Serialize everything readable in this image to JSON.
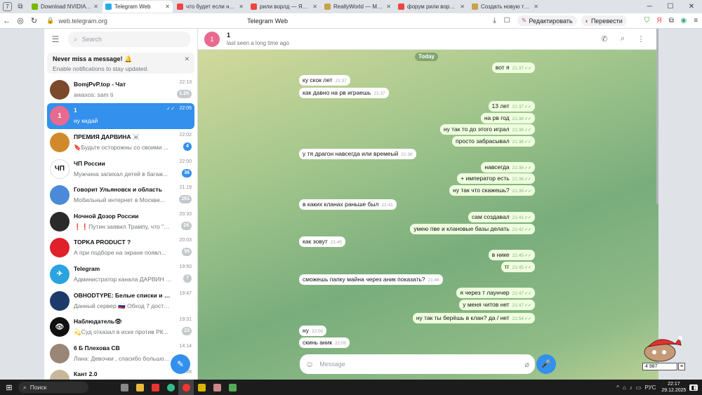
{
  "browser": {
    "tab_count": "7",
    "tabs": [
      {
        "label": "Download NVIDIA App for",
        "color": "#76b900"
      },
      {
        "label": "Telegram Web",
        "color": "#2aabee",
        "active": true
      },
      {
        "label": "что будет если написать",
        "color": "#e44"
      },
      {
        "label": "рили ворлд — Яндекс: на",
        "color": "#e44"
      },
      {
        "label": "ReallyWorld — Магазин пр",
        "color": "#c8a24a"
      },
      {
        "label": "форум рили ворлд — Ян",
        "color": "#e44"
      },
      {
        "label": "Создать новую тему - Rea",
        "color": "#c8a24a"
      }
    ],
    "url": "web.telegram.org",
    "page_title": "Telegram Web",
    "edit_label": "Редактировать",
    "translate_label": "Перевести"
  },
  "sidebar": {
    "search_placeholder": "Search",
    "notice_title": "Never miss a message! 🔔",
    "notice_sub": "Enable notifications to stay updated.",
    "chats": [
      {
        "name": "BomjPvP.top - Чат",
        "preview": "awaxos: sam ti",
        "time": "22:13",
        "badge": "1.2K",
        "avatar_color": "#7a4a2a",
        "avatar_text": ""
      },
      {
        "name": "1",
        "preview": "ну кидай",
        "time": "22:05",
        "badge": "",
        "avatar_color": "#e86a8e",
        "avatar_text": "1",
        "selected": true
      },
      {
        "name": "ПРЕМИЯ ДАРВИНА ☠️",
        "preview": "🔖Будьте осторожны со своими ...",
        "time": "22:02",
        "badge": "4",
        "badge_blue": true,
        "avatar_color": "#d08a2c",
        "avatar_text": ""
      },
      {
        "name": "ЧП России",
        "preview": "Мужчина запихал детей в багаж...",
        "time": "22:00",
        "badge": "36",
        "badge_blue": true,
        "avatar_color": "#ffffff",
        "avatar_text": "ЧП"
      },
      {
        "name": "Говорит Ульяновск и область",
        "preview": "Мобильный интернет в Москве...",
        "time": "21:19",
        "badge": "161",
        "avatar_color": "#4a8ad8",
        "avatar_text": ""
      },
      {
        "name": "Ночной Дозор России",
        "preview": "❗️❗️Путин заявил Трампу, что \"тер...",
        "time": "20:33",
        "badge": "1K",
        "avatar_color": "#2a2a2a",
        "avatar_text": ""
      },
      {
        "name": "TOPKA PRODUCT ?",
        "preview": "А при подборе на экране появл...",
        "time": "20:03",
        "badge": "58",
        "avatar_color": "#e0202a",
        "avatar_text": ""
      },
      {
        "name": "Telegram",
        "preview": "Администратор канала ДАРВИН КРА...",
        "time": "19:50",
        "badge": "7",
        "avatar_color": "#2aa3e0",
        "avatar_text": "✈"
      },
      {
        "name": "OBHODTYPE: Белые списки и Ютуб",
        "preview": "Данный сервер 🇷🇺 Обход 7 доступен тол...",
        "time": "19:47",
        "badge": "",
        "avatar_color": "#1e3a6a",
        "avatar_text": ""
      },
      {
        "name": "Наблюдатель👁",
        "preview": "💫Суд отказал в иске против РК...",
        "time": "19:31",
        "badge": "23",
        "avatar_color": "#111111",
        "avatar_text": "👁"
      },
      {
        "name": "6 Б Плехова СВ",
        "preview": "Лана: Девочки , спасибо большое за",
        "time": "14:14",
        "badge": "",
        "avatar_color": "#9a8676",
        "avatar_text": ""
      },
      {
        "name": "Кант 2.0",
        "preview": "",
        "time": "Dec 28",
        "badge": "",
        "avatar_color": "#c8b89a",
        "avatar_text": ""
      }
    ]
  },
  "chat": {
    "title": "1",
    "status": "last seen a long time ago",
    "avatar_text": "1",
    "date_label": "Today",
    "composer_placeholder": "Message",
    "messages": [
      {
        "text": "вот я",
        "time": "21:37",
        "out": true
      },
      {
        "text": "ку скок лет",
        "time": "21:37",
        "out": false
      },
      {
        "text": "как давно на рв играешь",
        "time": "21:37",
        "out": false
      },
      {
        "text": "13 лет",
        "time": "21:37",
        "out": true
      },
      {
        "text": "на рв год",
        "time": "21:38",
        "out": true
      },
      {
        "text": "ну так то до этого играл",
        "time": "21:38",
        "out": true
      },
      {
        "text": "просто забрасывал",
        "time": "21:38",
        "out": true
      },
      {
        "text": "у тя драгон навсегда или времеый",
        "time": "21:38",
        "out": false
      },
      {
        "text": "навсегда",
        "time": "21:38",
        "out": true
      },
      {
        "text": "+ император есть",
        "time": "21:38",
        "out": true
      },
      {
        "text": "ну так что скажешь?",
        "time": "21:39",
        "out": true
      },
      {
        "text": "в каких кланах раньше был",
        "time": "21:41",
        "out": false
      },
      {
        "text": "сам создавал",
        "time": "21:41",
        "out": true
      },
      {
        "text": "умею пве и клановые базы делать",
        "time": "21:42",
        "out": true
      },
      {
        "text": "как зовут",
        "time": "21:45",
        "out": false
      },
      {
        "text": "в нике",
        "time": "21:45",
        "out": true
      },
      {
        "text": "тг",
        "time": "21:45",
        "out": true
      },
      {
        "text": "сможешь папку майна через аник показать?",
        "time": "21:46",
        "out": false
      },
      {
        "text": "я через т лаунчер",
        "time": "21:47",
        "out": true
      },
      {
        "text": "у меня читов нет",
        "time": "21:47",
        "out": true
      },
      {
        "text": "ну так ты берёшь в клан? да / нет",
        "time": "21:54",
        "out": true
      },
      {
        "text": "ну",
        "time": "22:00",
        "out": false
      },
      {
        "text": "скинь аник",
        "time": "22:00",
        "out": false
      }
    ]
  },
  "gadget": {
    "counter": "4 987"
  },
  "taskbar": {
    "search_label": "Поиск",
    "lang": "РУС",
    "time": "22:17",
    "date": "29.12.2025"
  }
}
